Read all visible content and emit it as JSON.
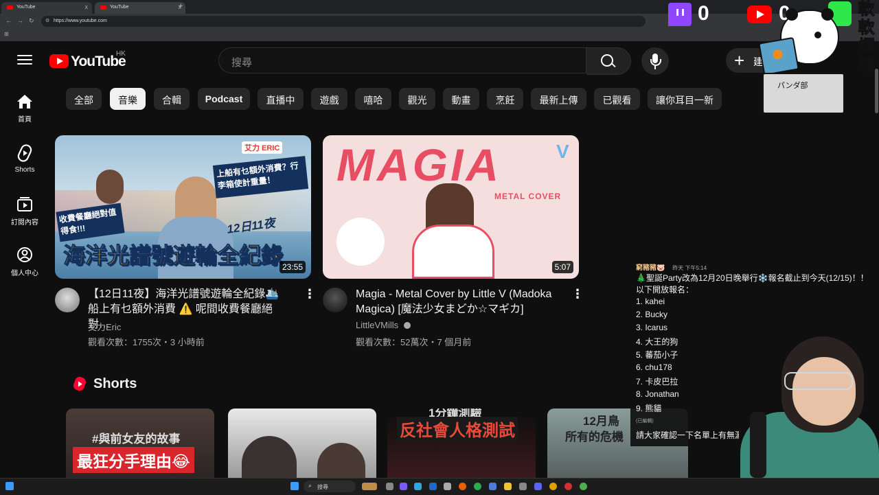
{
  "browser": {
    "tabs": [
      {
        "title": "YouTube"
      },
      {
        "title": "YouTube"
      }
    ],
    "new_tab": "+",
    "close_glyph": "x",
    "url": "https://www.youtube.com",
    "bookmarks_glyph": "⊞"
  },
  "header": {
    "logo_text": "YouTube",
    "region": "HK",
    "search_placeholder": "搜尋",
    "create_label": "建"
  },
  "sidebar": {
    "items": [
      {
        "label": "首頁",
        "icon": "home-icon"
      },
      {
        "label": "Shorts",
        "icon": "shorts-icon"
      },
      {
        "label": "訂閱內容",
        "icon": "subscriptions-icon"
      },
      {
        "label": "個人中心",
        "icon": "account-icon"
      }
    ]
  },
  "chips": [
    "全部",
    "音樂",
    "合輯",
    "Podcast",
    "直播中",
    "遊戲",
    "嘻哈",
    "觀光",
    "動畫",
    "烹飪",
    "最新上傳",
    "已觀看",
    "讓你耳目一新"
  ],
  "selected_chip": "音樂",
  "videos": [
    {
      "title_line1": "【12日11夜】海洋光譜號遊輪全紀錄🛳️",
      "title_line2": "船上有乜額外消費 ⚠️ 呢間收費餐廳絕對…",
      "channel": "艾力Eric",
      "meta": "觀看次數：1755次・3 小時前",
      "duration": "23:55",
      "thumb_text": "海洋光譜號遊輪全紀錄",
      "thumb_badge": "12日11夜",
      "thumb_side": "上船有乜額外消費？行李箱使計重量！",
      "thumb_left": "收費餐廳絕對值得食!!!",
      "thumb_brand": "艾力 ERIC"
    },
    {
      "title_line1": "Magia -  Metal Cover by Little V (Madoka",
      "title_line2": "Magica) [魔法少女まどか☆マギカ]",
      "channel": "LittleVMills",
      "meta": "觀看次數：52萬次・7 個月前",
      "duration": "5:07",
      "thumb_text": "MAGIA",
      "thumb_sub": "METAL COVER",
      "thumb_v": "V"
    }
  ],
  "shorts": {
    "title": "Shorts",
    "items": [
      {
        "top_text": "#與前女友的故事",
        "main_text": "最狂分手理由😂"
      },
      {
        "top_text": "",
        "main_text": ""
      },
      {
        "top_text": "1分鐘測驗",
        "main_text": "反社會人格測試"
      },
      {
        "top_text": "12月鳥",
        "main_text": "所有的危機"
      }
    ]
  },
  "stream_overlay": {
    "twitch_count": "0",
    "youtube_count": "0",
    "sticker_text": "パンダ部",
    "side_chars": "軟軟爛爛"
  },
  "chat": {
    "user": "窮豬豬🐷",
    "time": "昨天 下午5:14",
    "line1": "🎄聖誕Party改為12月20日晚舉行❄️報名截止到今天(12/15)！！",
    "line2": "以下開放報名：",
    "entries": [
      "1. kahei",
      "2. Bucky",
      "3. Icarus",
      "4. 大王的狗",
      "5. 蕃茄小子",
      "6. chu178",
      "7. 卡皮巴拉",
      "8. Jonathan",
      "9. 熊貓"
    ],
    "edited": "(已編輯)",
    "footer": "請大家確認一下名單上有無漏"
  },
  "taskbar": {
    "search": "搜尋"
  },
  "colors": {
    "brand_red": "#ff0000",
    "twitch_purple": "#9146ff",
    "bg": "#0f0f0f"
  }
}
